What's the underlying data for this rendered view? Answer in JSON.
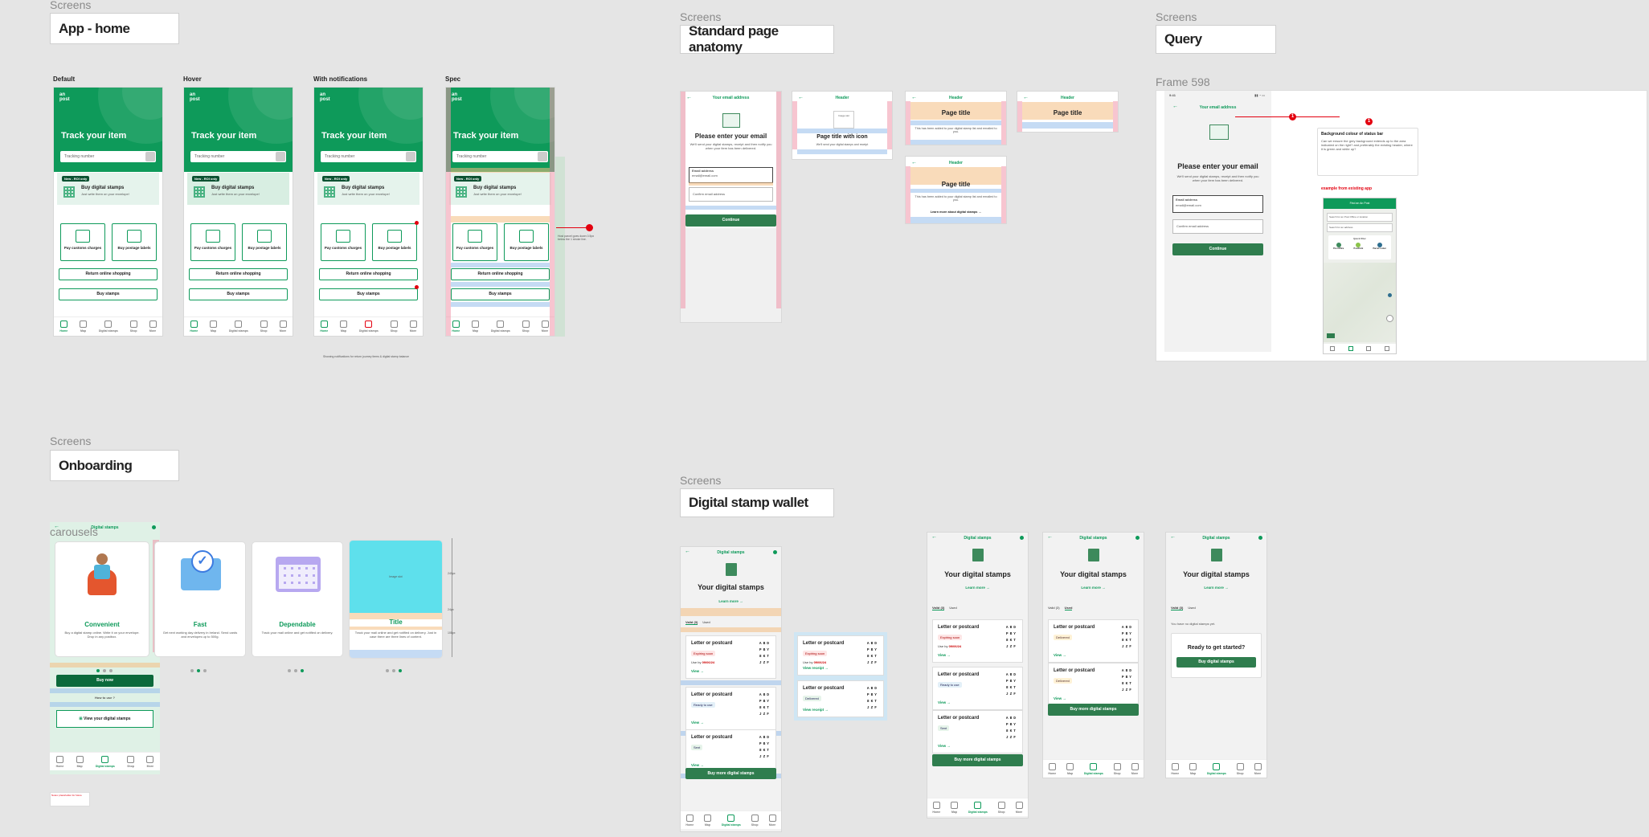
{
  "sections": {
    "app_home": {
      "label": "Screens",
      "title": "App - home"
    },
    "anatomy": {
      "label": "Screens",
      "title": "Standard page anatomy"
    },
    "query": {
      "label": "Screens",
      "title": "Query",
      "frame_label": "Frame 598"
    },
    "onboarding": {
      "label": "Screens",
      "title": "Onboarding",
      "carousels_label": "carousels"
    },
    "wallet": {
      "label": "Screens",
      "title": "Digital stamp wallet"
    }
  },
  "home": {
    "variants": [
      "Default",
      "Hover",
      "With notifications",
      "Spec"
    ],
    "logo": "an\npost",
    "track_title": "Track your item",
    "search_placeholder": "Tracking number",
    "promo_pill": "New - ROI only",
    "promo_title": "Buy digital stamps",
    "promo_sub": "Just write them on your envelope!",
    "tile1": "Pay customs charges",
    "tile2": "Buy postage labels",
    "btn_return": "Return online shopping",
    "btn_stamps": "Buy stamps",
    "tabs": [
      "Home",
      "Map",
      "Digital stamps",
      "Shop",
      "More"
    ],
    "notification_note": "Showing notifications for return journey items & digital stamp balance",
    "spec_note": "Host parcel goes down 0.5px below the 1 stroke line."
  },
  "anatomy": {
    "email_header": "Your email address",
    "email_title": "Please enter your email",
    "email_body": "We'll send your digital stamps, receipt and then notify you when your item has been delivered.",
    "email_label": "Email address",
    "email_value": "email@email.com",
    "confirm_placeholder": "Confirm email address",
    "continue": "Continue",
    "header": "Header",
    "image_box": "Image slot",
    "page_title_icon": "Page title with icon",
    "page_title": "Page title",
    "icon_body": "We'll send your digital stamps and receipt",
    "added_body": "This has been added to your digital stamp list and emailed to you.",
    "learn_more": "Learn more about digital stamps →"
  },
  "query": {
    "time": "9:41",
    "header": "Your email address",
    "title": "Please enter your email",
    "body": "We'll send your digital stamps, receipt and then notify you when your item has been delivered.",
    "email_label": "Email address",
    "email_value": "email@email.com",
    "confirm": "Confirm email address",
    "continue": "Continue",
    "pin": "1",
    "comment_title": "Background colour of status bar",
    "comment_body": "Can we ensure the grey background extends up to the area indicated on the right? and preferably the existing header, where it is green and white up?",
    "example_label": "example from existing app",
    "map_header": "Find an An Post",
    "map_search1": "Search for an Post Office or location",
    "map_search2": "Search for an address",
    "map_quick": "Quick filter",
    "map_opts": [
      "Post Office",
      "PostPoint",
      "Parcel Locker"
    ]
  },
  "onboarding": {
    "header": "Digital stamps",
    "slides": [
      {
        "title": "Convenient",
        "body": "Buy a digital stamp online. Write it on your envelope. Drop in any postbox."
      },
      {
        "title": "Fast",
        "body": "Get next working day delivery in Ireland. Send cards and envelopes up to 500g."
      },
      {
        "title": "Dependable",
        "body": "Track your mail online and get notified on delivery."
      },
      {
        "title": "Title",
        "body": "Track your mail online and get notified on delivery. Just in case there are three lines of content."
      }
    ],
    "image_slot": "Image slot",
    "dim1": "240px",
    "dim2": "24px",
    "dim3": "108px",
    "buy_now": "Buy now",
    "how_to_use": "How to use",
    "view_stamps": "View your digital stamps",
    "tabs": [
      "Home",
      "Map",
      "Digital stamps",
      "Shop",
      "More"
    ],
    "footnote": "Notes: placeholder for future"
  },
  "wallet": {
    "header": "Digital stamps",
    "title": "Your digital stamps",
    "learn": "Learn more →",
    "tab_valid": "Valid (3)",
    "tab_used": "Used",
    "card_title": "Letter or postcard",
    "tag_expiring": "Expiring soon",
    "tag_ready": "Ready to use",
    "tag_sent": "Sent",
    "tag_delivered": "Delivered",
    "use_by": "Use by",
    "date": "09/06/24",
    "view": "View →",
    "code": [
      "ABD",
      "PBY",
      "8KT",
      "JZF"
    ],
    "buy_more": "Buy more digital stamps",
    "empty_title": "Ready to get started?",
    "empty_body": "You have no digital stamps yet.",
    "buy_digital": "Buy digital stamps",
    "view_receipt": "View receipt →",
    "tabs": [
      "Home",
      "Map",
      "Digital stamps",
      "Shop",
      "More"
    ]
  },
  "colors": {
    "brand": "#0e9a5a",
    "dark_green": "#2f7d4e",
    "alert": "#e3000f",
    "canvas": "#e5e5e5"
  }
}
